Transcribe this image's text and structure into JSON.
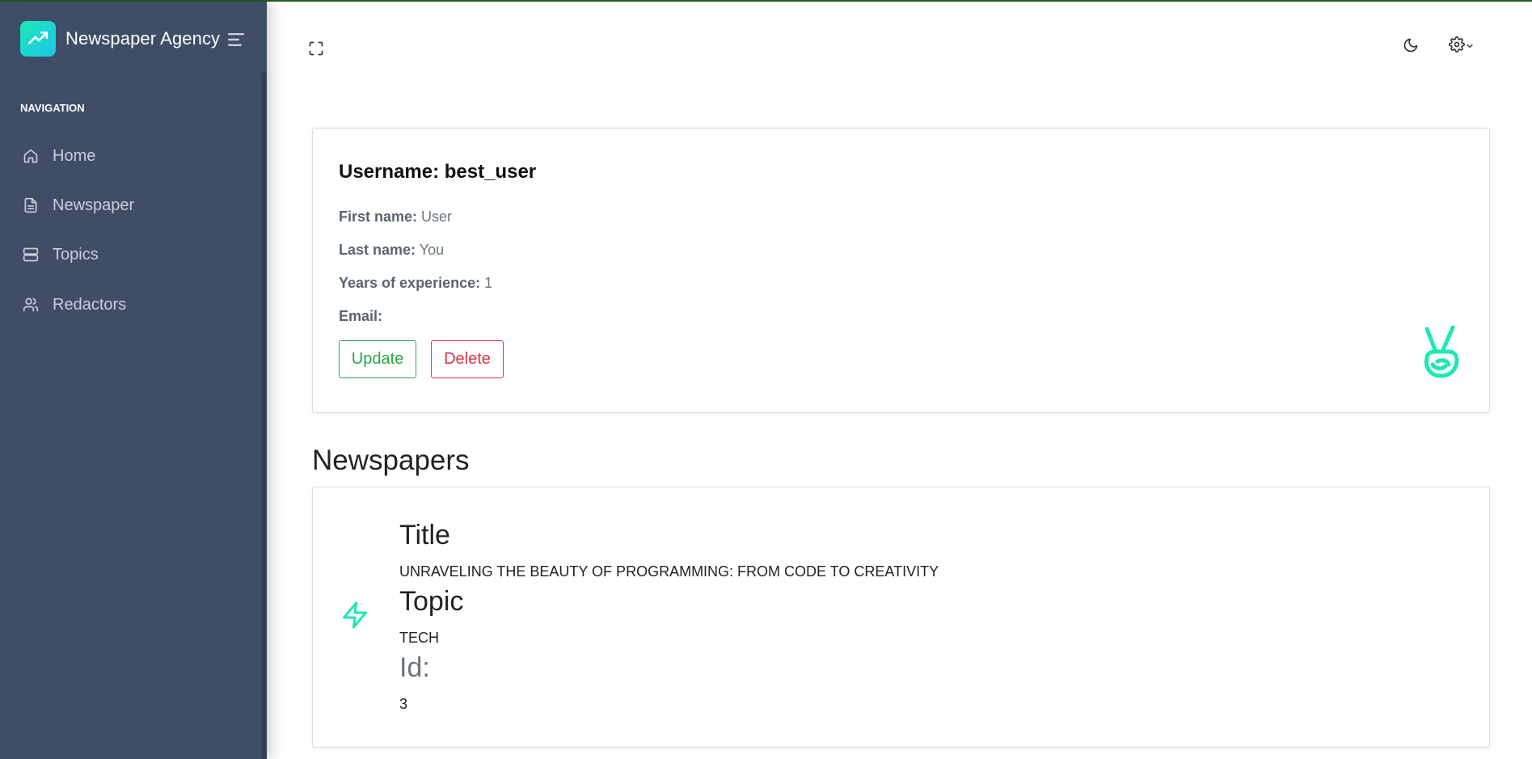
{
  "app": {
    "name": "Newspaper Agency",
    "accent": "#1de9b6",
    "sidebar_bg": "#3f4d67"
  },
  "sidebar": {
    "caption": "NAVIGATION",
    "items": [
      {
        "label": "Home",
        "icon": "home-icon"
      },
      {
        "label": "Newspaper",
        "icon": "file-text-icon"
      },
      {
        "label": "Topics",
        "icon": "server-icon"
      },
      {
        "label": "Redactors",
        "icon": "users-icon"
      }
    ]
  },
  "header": {
    "fullscreen_icon": "fullscreen-icon",
    "theme_icon": "moon-icon",
    "settings_icon": "gear-icon"
  },
  "profile": {
    "username_label": "Username:",
    "username": "best_user",
    "fields": [
      {
        "label": "First name:",
        "value": "User"
      },
      {
        "label": "Last name:",
        "value": "You"
      },
      {
        "label": "Years of experience:",
        "value": "1"
      },
      {
        "label": "Email:",
        "value": ""
      }
    ],
    "update_label": "Update",
    "delete_label": "Delete",
    "update_color": "#28a745",
    "delete_color": "#dc3545"
  },
  "newspapers": {
    "section_title": "Newspapers",
    "item": {
      "title_heading": "Title",
      "title": "UNRAVELING THE BEAUTY OF PROGRAMMING: FROM CODE TO CREATIVITY",
      "topic_heading": "Topic",
      "topic": "TECH",
      "id_heading": "Id:",
      "id": "3"
    }
  }
}
